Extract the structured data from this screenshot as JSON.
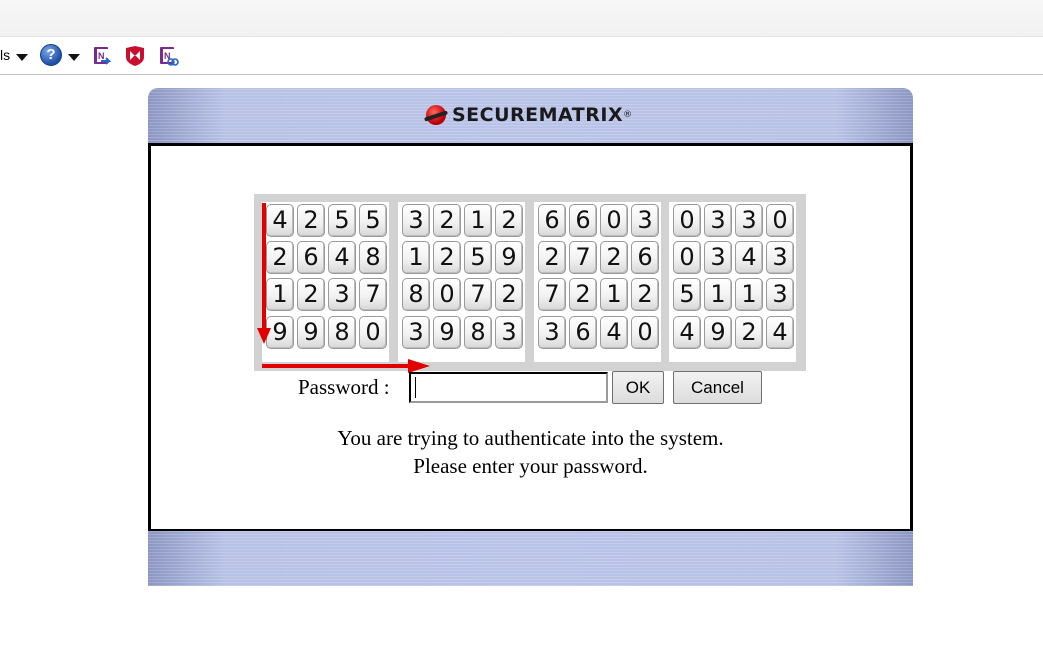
{
  "toolbar": {
    "tools_label_fragment": "ls",
    "help_glyph": "?",
    "icons": [
      "tools-dropdown-caret",
      "help-icon",
      "help-dropdown-caret",
      "onenote-send-icon",
      "mcafee-icon",
      "onenote-linked-notes-icon"
    ]
  },
  "brand": {
    "name": "SECUREMATRIX",
    "registered_mark": "®",
    "logo_color": "#d0000b"
  },
  "matrix": {
    "blocks": [
      [
        [
          "4",
          "2",
          "5",
          "5"
        ],
        [
          "2",
          "6",
          "4",
          "8"
        ],
        [
          "1",
          "2",
          "3",
          "7"
        ],
        [
          "9",
          "9",
          "8",
          "0"
        ]
      ],
      [
        [
          "3",
          "2",
          "1",
          "2"
        ],
        [
          "1",
          "2",
          "5",
          "9"
        ],
        [
          "8",
          "0",
          "7",
          "2"
        ],
        [
          "3",
          "9",
          "8",
          "3"
        ]
      ],
      [
        [
          "6",
          "6",
          "0",
          "3"
        ],
        [
          "2",
          "7",
          "2",
          "6"
        ],
        [
          "7",
          "2",
          "1",
          "2"
        ],
        [
          "3",
          "6",
          "4",
          "0"
        ]
      ],
      [
        [
          "0",
          "3",
          "3",
          "0"
        ],
        [
          "0",
          "3",
          "4",
          "3"
        ],
        [
          "5",
          "1",
          "1",
          "3"
        ],
        [
          "4",
          "9",
          "2",
          "4"
        ]
      ]
    ],
    "annotation_color": "#e00000"
  },
  "form": {
    "password_label": "Password :",
    "password_value": "",
    "ok_label": "OK",
    "cancel_label": "Cancel"
  },
  "message": {
    "line1": "You are trying to authenticate into the system.",
    "line2": "Please enter your password."
  },
  "colors": {
    "header_band": "#b7c1e6",
    "border": "#000000"
  }
}
